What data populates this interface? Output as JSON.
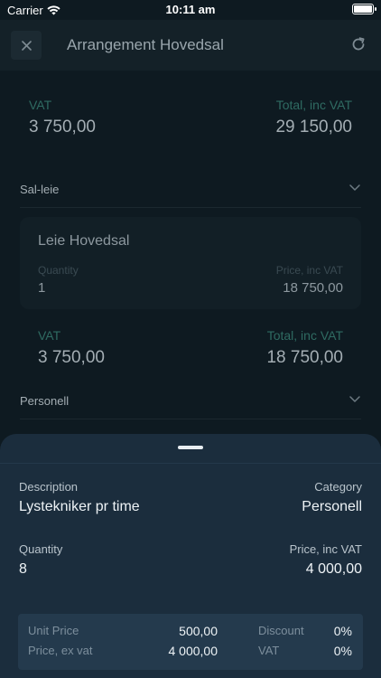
{
  "status_bar": {
    "carrier": "Carrier",
    "time": "10:11 am"
  },
  "header": {
    "title": "Arrangement Hovedsal",
    "close_icon": "close-icon",
    "refresh_icon": "refresh-icon"
  },
  "summary": {
    "vat_label": "VAT",
    "vat_value": "3 750,00",
    "total_label": "Total, inc VAT",
    "total_value": "29 150,00"
  },
  "sections": [
    {
      "label": "Sal-leie",
      "item": {
        "title": "Leie Hovedsal",
        "quantity_label": "Quantity",
        "quantity_value": "1",
        "price_label": "Price, inc VAT",
        "price_value": "18 750,00"
      },
      "subtotal": {
        "vat_label": "VAT",
        "vat_value": "3 750,00",
        "total_label": "Total, inc VAT",
        "total_value": "18 750,00"
      }
    },
    {
      "label": "Personell"
    }
  ],
  "sheet": {
    "description_label": "Description",
    "description_value": "Lystekniker pr time",
    "category_label": "Category",
    "category_value": "Personell",
    "quantity_label": "Quantity",
    "quantity_value": "8",
    "price_label": "Price, inc VAT",
    "price_value": "4 000,00",
    "unit_price_label": "Unit Price",
    "unit_price_value": "500,00",
    "price_ex_vat_label": "Price, ex vat",
    "price_ex_vat_value": "4 000,00",
    "discount_label": "Discount",
    "discount_value": "0%",
    "vat_label": "VAT",
    "vat_value": "0%"
  },
  "colors": {
    "background": "#0e1a21",
    "sheet": "#1b2d3d",
    "accent_label": "#2f6b62"
  }
}
